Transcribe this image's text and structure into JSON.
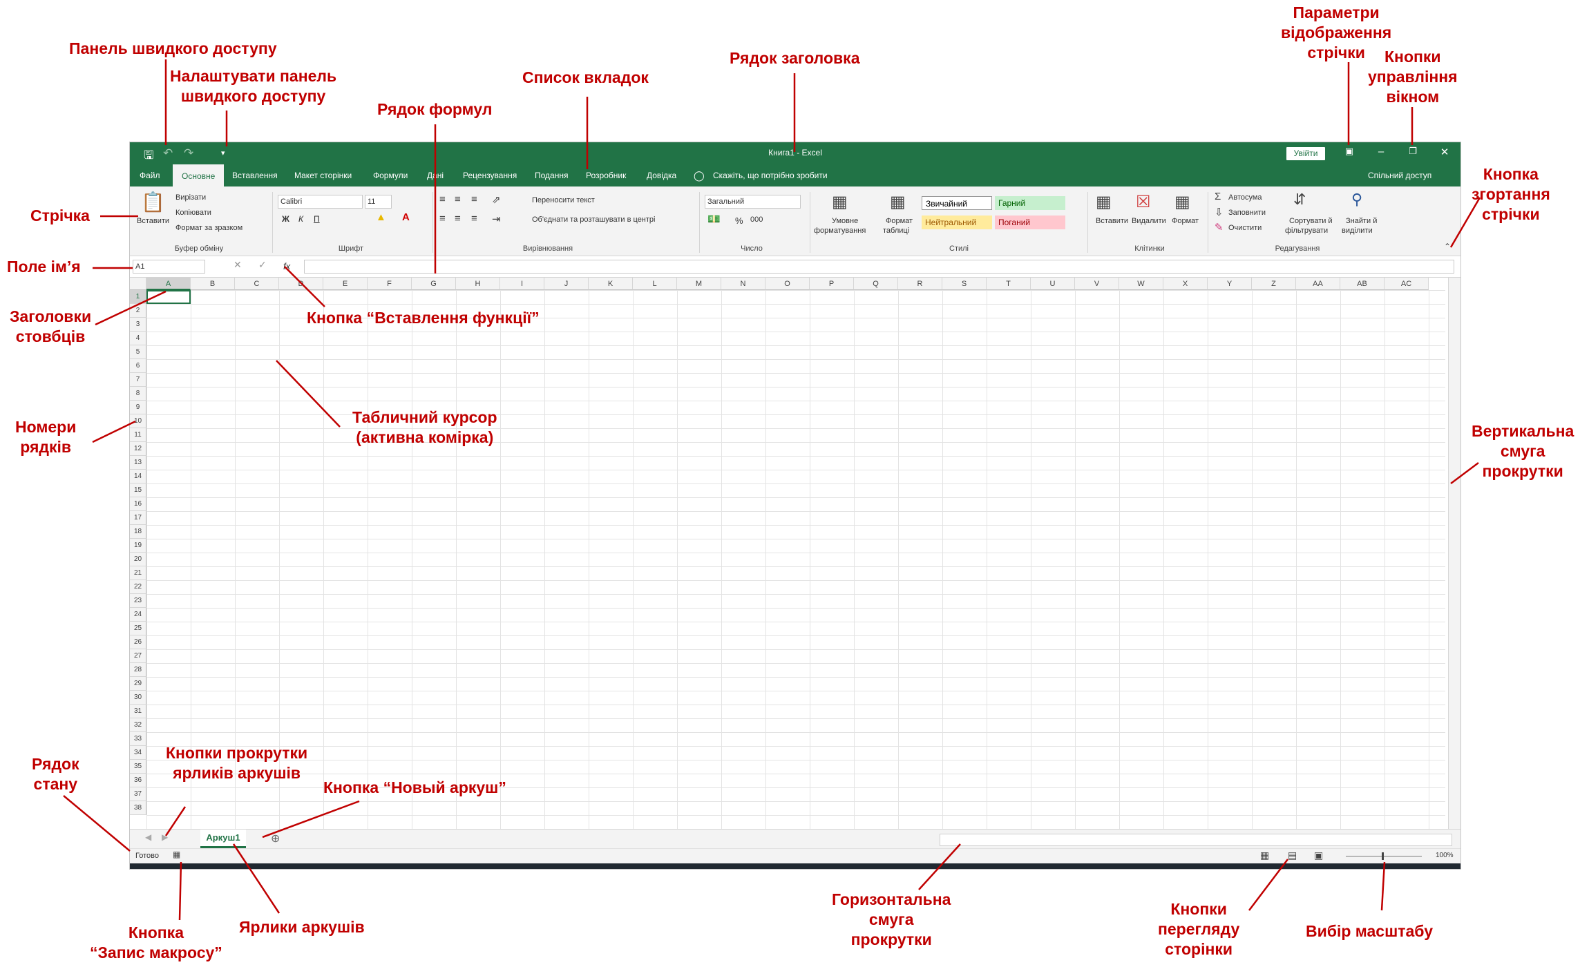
{
  "window": {
    "title": "Книга1  -  Excel",
    "sign_in": "Увійти",
    "accent": "#217346",
    "tabs": [
      "Файл",
      "Основне",
      "Вставлення",
      "Макет сторінки",
      "Формули",
      "Дані",
      "Рецензування",
      "Подання",
      "Розробник",
      "Довідка"
    ],
    "tell_me": "Скажіть, що потрібно зробити",
    "share": "Спільний доступ"
  },
  "ribbon": {
    "clipboard": {
      "paste": "Вставити",
      "cut": "Вирізати",
      "copy": "Копіювати",
      "format_painter": "Формат за зразком",
      "label": "Буфер обміну"
    },
    "font": {
      "name": "Calibri",
      "size": "11",
      "bold": "Ж",
      "italic": "К",
      "underline": "П",
      "label": "Шрифт"
    },
    "alignment": {
      "wrap": "Переносити текст",
      "merge": "Об'єднати та розташувати в центрі",
      "label": "Вирівнювання"
    },
    "number": {
      "format": "Загальний",
      "percent": "%",
      "thousands": "000",
      "label": "Число"
    },
    "styles": {
      "conditional": [
        "Умовне",
        "форматування"
      ],
      "as_table": [
        "Формат",
        "таблиці"
      ],
      "normal": "Звичайний",
      "good": "Гарний",
      "neutral": "Нейтральний",
      "bad": "Поганий",
      "label": "Стилі"
    },
    "cells": {
      "insert": "Вставити",
      "delete": "Видалити",
      "format": "Формат",
      "label": "Клітинки"
    },
    "editing": {
      "autosum": "Автосума",
      "fill": "Заповнити",
      "clear": "Очистити",
      "sort": [
        "Сортувати й",
        "фільтрувати"
      ],
      "find": [
        "Знайти й",
        "виділити"
      ],
      "label": "Редагування"
    }
  },
  "formula_bar": {
    "name_box": "A1",
    "fx": "fx"
  },
  "grid": {
    "columns": [
      "A",
      "B",
      "C",
      "D",
      "E",
      "F",
      "G",
      "H",
      "I",
      "J",
      "K",
      "L",
      "M",
      "N",
      "O",
      "P",
      "Q",
      "R",
      "S",
      "T",
      "U",
      "V",
      "W",
      "X",
      "Y",
      "Z",
      "AA",
      "AB",
      "AC"
    ],
    "rows": [
      "1",
      "2",
      "3",
      "4",
      "5",
      "6",
      "7",
      "8",
      "9",
      "10",
      "11",
      "12",
      "13",
      "14",
      "15",
      "16",
      "17",
      "18",
      "19",
      "20",
      "21",
      "22",
      "23",
      "24",
      "25",
      "26",
      "27",
      "28",
      "29",
      "30",
      "31",
      "32",
      "33",
      "34",
      "35",
      "36",
      "37",
      "38"
    ]
  },
  "sheets": {
    "active": "Аркуш1"
  },
  "status": {
    "ready": "Готово",
    "zoom": "100%"
  },
  "annotations": {
    "qat": "Панель швидкого доступу",
    "qat_customize": [
      "Налаштувати панель",
      "швидкого доступу"
    ],
    "formula_row": "Рядок формул",
    "tab_list": "Список вкладок",
    "title_row": "Рядок заголовка",
    "ribbon_display": [
      "Параметри",
      "відображення",
      "стрічки"
    ],
    "window_controls": [
      "Кнопки",
      "управління",
      "вікном"
    ],
    "ribbon_collapse": [
      "Кнопка",
      "згортання",
      "стрічки"
    ],
    "ribbon": "Стрічка",
    "name_box": "Поле ім’я",
    "col_headers": [
      "Заголовки",
      "стовбців"
    ],
    "insert_fn": "Кнопка “Вставлення функції”",
    "row_numbers": [
      "Номери",
      "рядків"
    ],
    "cursor": [
      "Табличний курсор",
      "(активна комірка)"
    ],
    "vscroll": [
      "Вертикальна",
      "смуга",
      "прокрутки"
    ],
    "status_row": [
      "Рядок",
      "стану"
    ],
    "sheet_scroll": [
      "Кнопки прокрутки",
      "ярликів аркушів"
    ],
    "new_sheet": "Кнопка “Новый аркуш”",
    "macro": [
      "Кнопка",
      "“Запис макросу”"
    ],
    "sheet_tabs": "Ярлики аркушів",
    "hscroll": [
      "Горизонтальна",
      "смуга",
      "прокрутки"
    ],
    "view_buttons": [
      "Кнопки",
      "перегляду",
      "сторінки"
    ],
    "zoom": "Вибір масштабу"
  }
}
